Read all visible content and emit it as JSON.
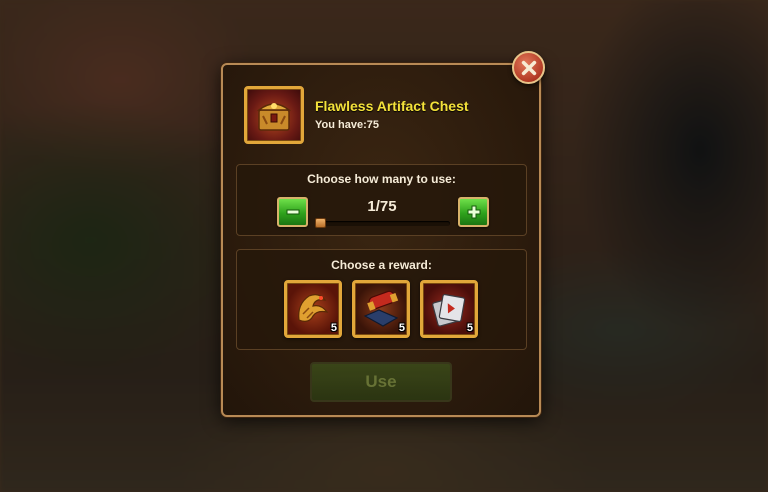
{
  "dialog": {
    "item_name": "Flawless Artifact Chest",
    "you_have": "You have:75",
    "chest_icon": "artifact-chest-icon",
    "close_icon": "close-x-icon"
  },
  "quantity": {
    "label": "Choose how many to use:",
    "counter": "1/75",
    "current": 1,
    "max": 75,
    "minus_icon": "minus-icon",
    "plus_icon": "plus-icon"
  },
  "reward": {
    "label": "Choose a reward:",
    "items": [
      {
        "icon": "golden-dragon-artifact-icon",
        "count": "5"
      },
      {
        "icon": "red-scroll-book-artifact-icon",
        "count": "5"
      },
      {
        "icon": "grey-cards-artifact-icon",
        "count": "5"
      }
    ]
  },
  "actions": {
    "use_label": "Use"
  },
  "colors": {
    "title": "#f4e23a",
    "border_gold": "#e2a73a",
    "button_green": "#2fa21c",
    "close_red": "#b23a24"
  }
}
